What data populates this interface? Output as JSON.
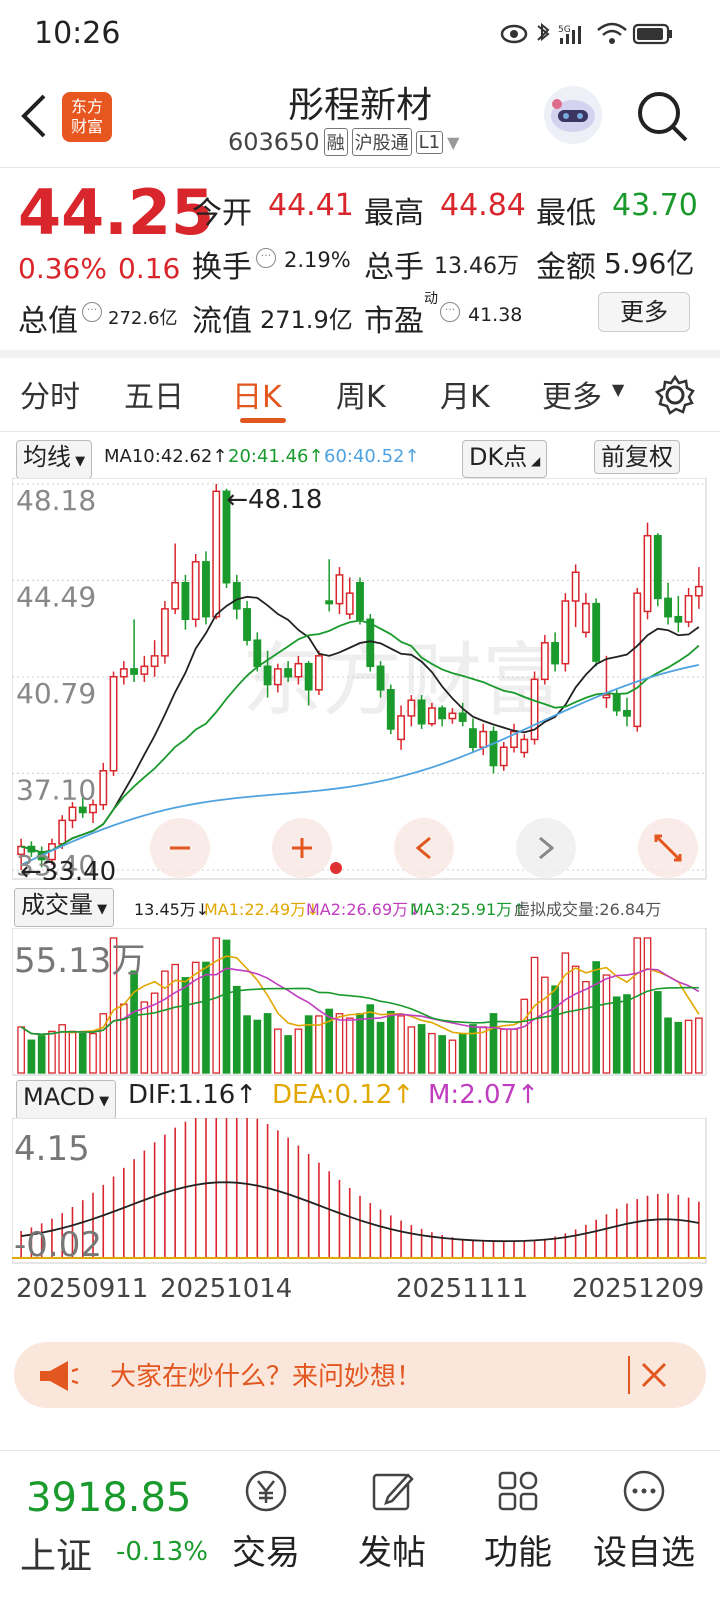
{
  "status": {
    "time": "10:26",
    "network": "5G"
  },
  "header": {
    "title": "彤程新材",
    "code": "603650",
    "tags": [
      "融",
      "沪股通",
      "L1"
    ],
    "app_logo_line1": "东方",
    "app_logo_line2": "财富"
  },
  "quote": {
    "price": "44.25",
    "change_pct": "0.36%",
    "change_amt": "0.16",
    "open_label": "今开",
    "open": "44.41",
    "high_label": "最高",
    "high": "44.84",
    "low_label": "最低",
    "low": "43.70",
    "turnover_label": "换手",
    "turnover": "2.19%",
    "volume_label": "总手",
    "volume": "13.46万",
    "amount_label": "金额",
    "amount": "5.96亿",
    "mcap_label": "总值",
    "mcap": "272.6亿",
    "float_label": "流值",
    "float": "271.9亿",
    "pe_label": "市盈",
    "pe_sup": "动",
    "pe": "41.38",
    "more_label": "更多"
  },
  "tabs": [
    {
      "label": "分时",
      "active": false
    },
    {
      "label": "五日",
      "active": false
    },
    {
      "label": "日K",
      "active": true
    },
    {
      "label": "周K",
      "active": false
    },
    {
      "label": "月K",
      "active": false
    },
    {
      "label": "更多",
      "active": false
    }
  ],
  "kline": {
    "ma_selector": "均线",
    "ma10": "MA10:42.62↑",
    "ma20": "20:41.46↑",
    "ma60": "60:40.52↑",
    "dk_label": "DK点",
    "adjust_label": "前复权",
    "y_ticks": [
      "48.18",
      "44.49",
      "40.79",
      "37.10",
      "33.40"
    ],
    "max_marker": "48.18",
    "min_marker": "33.40",
    "watermark": "东方财富"
  },
  "volume": {
    "selector": "成交量",
    "current": "13.45万↓",
    "ma1": "MA1:22.49万↓",
    "ma2": "MA2:26.69万↓",
    "ma3": "MA3:25.91万↑",
    "virtual": "虚拟成交量:26.84万",
    "y_top": "55.13万"
  },
  "macd": {
    "selector": "MACD",
    "dif": "DIF:1.16↑",
    "dea": "DEA:0.12↑",
    "m": "M:2.07↑",
    "y_top": "4.15",
    "y_bottom": "-0.02"
  },
  "dates": [
    "20250911",
    "20251014",
    "20251111",
    "20251209"
  ],
  "banner": {
    "text": "大家在炒什么？来问妙想！"
  },
  "index": {
    "value": "3918.85",
    "name": "上证",
    "change": "-0.13%"
  },
  "nav": [
    {
      "label": "交易",
      "icon": "yen-icon"
    },
    {
      "label": "发帖",
      "icon": "edit-icon"
    },
    {
      "label": "功能",
      "icon": "grid-icon"
    },
    {
      "label": "设自选",
      "icon": "more-icon"
    }
  ],
  "colors": {
    "up": "#d9262c",
    "down": "#1a9a2c",
    "accent": "#e2561f",
    "ma10": "#222222",
    "ma20": "#1a9a2c",
    "ma60": "#4fa3e0"
  },
  "chart_data": {
    "type": "candlestick",
    "ohlc": [
      [
        34.0,
        34.6,
        33.4,
        34.3
      ],
      [
        34.3,
        34.5,
        33.9,
        34.1
      ],
      [
        34.1,
        34.3,
        33.5,
        33.8
      ],
      [
        33.8,
        34.6,
        33.6,
        34.4
      ],
      [
        34.4,
        35.5,
        34.2,
        35.3
      ],
      [
        35.3,
        36.0,
        35.0,
        35.8
      ],
      [
        35.8,
        36.3,
        35.4,
        35.6
      ],
      [
        35.6,
        36.1,
        35.2,
        35.9
      ],
      [
        35.9,
        37.5,
        35.7,
        37.2
      ],
      [
        37.2,
        41.0,
        37.0,
        40.8
      ],
      [
        40.8,
        41.4,
        40.5,
        41.1
      ],
      [
        41.1,
        43.0,
        40.6,
        40.9
      ],
      [
        40.9,
        41.6,
        40.6,
        41.2
      ],
      [
        41.2,
        42.2,
        40.8,
        41.6
      ],
      [
        41.6,
        43.7,
        41.3,
        43.4
      ],
      [
        43.4,
        45.9,
        43.2,
        44.4
      ],
      [
        44.4,
        44.7,
        42.6,
        43.0
      ],
      [
        43.0,
        45.5,
        42.7,
        45.2
      ],
      [
        45.2,
        45.6,
        42.8,
        43.1
      ],
      [
        43.1,
        48.18,
        43.0,
        47.9
      ],
      [
        47.9,
        48.0,
        44.2,
        44.4
      ],
      [
        44.4,
        44.7,
        43.0,
        43.4
      ],
      [
        43.4,
        43.7,
        42.0,
        42.2
      ],
      [
        42.2,
        42.5,
        41.0,
        41.2
      ],
      [
        41.2,
        41.8,
        40.0,
        40.5
      ],
      [
        40.5,
        41.3,
        40.2,
        41.1
      ],
      [
        41.1,
        41.4,
        40.6,
        40.8
      ],
      [
        40.8,
        41.6,
        40.5,
        41.3
      ],
      [
        41.3,
        41.4,
        39.7,
        40.3
      ],
      [
        40.3,
        41.8,
        40.1,
        41.6
      ],
      [
        43.7,
        45.3,
        43.3,
        43.6
      ],
      [
        43.6,
        45.0,
        43.2,
        44.7
      ],
      [
        43.2,
        44.6,
        43.0,
        44.0
      ],
      [
        44.4,
        44.6,
        42.8,
        43.0
      ],
      [
        43.0,
        43.2,
        41.0,
        41.2
      ],
      [
        41.2,
        41.4,
        40.0,
        40.3
      ],
      [
        40.3,
        40.5,
        38.6,
        38.8
      ],
      [
        38.4,
        39.7,
        38.0,
        39.3
      ],
      [
        39.3,
        40.1,
        38.9,
        39.9
      ],
      [
        39.9,
        40.1,
        38.8,
        39.0
      ],
      [
        39.0,
        39.8,
        38.9,
        39.6
      ],
      [
        39.6,
        39.7,
        38.9,
        39.2
      ],
      [
        39.2,
        39.6,
        39.0,
        39.4
      ],
      [
        39.4,
        39.8,
        38.9,
        39.1
      ],
      [
        38.8,
        39.2,
        37.9,
        38.1
      ],
      [
        38.1,
        39.0,
        37.8,
        38.7
      ],
      [
        38.7,
        38.9,
        37.1,
        37.4
      ],
      [
        37.4,
        38.3,
        37.2,
        38.1
      ],
      [
        38.1,
        39.0,
        37.9,
        38.7
      ],
      [
        37.9,
        38.6,
        37.7,
        38.4
      ],
      [
        38.4,
        41.0,
        38.2,
        40.7
      ],
      [
        40.7,
        42.4,
        40.5,
        42.1
      ],
      [
        42.1,
        42.5,
        41.0,
        41.3
      ],
      [
        41.3,
        44.0,
        41.0,
        43.7
      ],
      [
        43.7,
        45.1,
        42.7,
        44.8
      ],
      [
        42.5,
        44.0,
        42.3,
        43.6
      ],
      [
        43.6,
        43.8,
        41.2,
        41.4
      ],
      [
        40.0,
        41.6,
        39.6,
        40.1
      ],
      [
        40.1,
        40.3,
        39.3,
        39.5
      ],
      [
        39.5,
        40.0,
        38.9,
        39.3
      ],
      [
        38.9,
        44.2,
        38.7,
        44.0
      ],
      [
        43.3,
        46.7,
        43.0,
        46.2
      ],
      [
        46.2,
        46.3,
        43.5,
        43.8
      ],
      [
        43.8,
        44.4,
        42.8,
        43.1
      ],
      [
        43.1,
        43.9,
        42.5,
        42.9
      ],
      [
        42.9,
        44.2,
        42.7,
        43.9
      ],
      [
        43.9,
        45.0,
        43.4,
        44.25
      ]
    ],
    "ylim": [
      33.4,
      48.18
    ]
  }
}
